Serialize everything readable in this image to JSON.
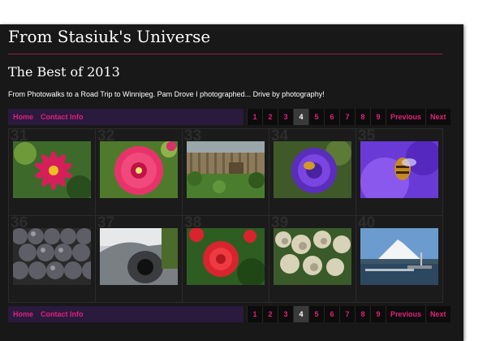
{
  "site": {
    "title": "From Stasiuk's Universe",
    "gallery_title": "The Best of 2013",
    "description": "From Photowalks to a Road Trip to Winnipeg. Pam Drove I photographed... Drive by photography!"
  },
  "nav": {
    "links": [
      "Home",
      "Contact Info"
    ],
    "pages": [
      "1",
      "2",
      "3",
      "4",
      "5",
      "6",
      "7",
      "8",
      "9"
    ],
    "current_page": "4",
    "previous": "Previous",
    "next": "Next"
  },
  "thumbnails": [
    {
      "number": "31",
      "subject": "pink daisy flower"
    },
    {
      "number": "32",
      "subject": "pink hollyhock flower"
    },
    {
      "number": "33",
      "subject": "garden with wooden fence"
    },
    {
      "number": "34",
      "subject": "purple thistle with bee"
    },
    {
      "number": "35",
      "subject": "bee on purple thistle"
    },
    {
      "number": "36",
      "subject": "stacked grey spheres"
    },
    {
      "number": "37",
      "subject": "fisheye car mirror reflection"
    },
    {
      "number": "38",
      "subject": "red roses"
    },
    {
      "number": "39",
      "subject": "white sedum flowers"
    },
    {
      "number": "40",
      "subject": "snowy mountain over harbour"
    }
  ]
}
